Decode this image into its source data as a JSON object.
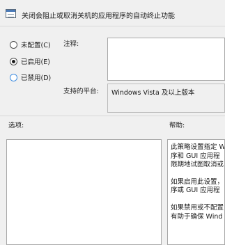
{
  "title": "关闭会阻止或取消关机的应用程序的自动终止功能",
  "radio_options": [
    {
      "label": "未配置(C)",
      "checked": false
    },
    {
      "label": "已启用(E)",
      "checked": true
    },
    {
      "label": "已禁用(D)",
      "checked": false
    }
  ],
  "comment_label": "注释:",
  "comment_value": "",
  "platform_label": "支持的平台:",
  "platform_value": "Windows Vista 及以上版本",
  "options_label": "选项:",
  "help_label": "帮助:",
  "help_paragraphs": [
    [
      "此策略设置指定 W",
      "序和 GUI 应用程",
      "限期地试图取消或"
    ],
    [
      "如果启用此设置，",
      "序或 GUI 应用程"
    ],
    [
      "如果禁用或不配置",
      "有助于确保 Wind"
    ]
  ]
}
